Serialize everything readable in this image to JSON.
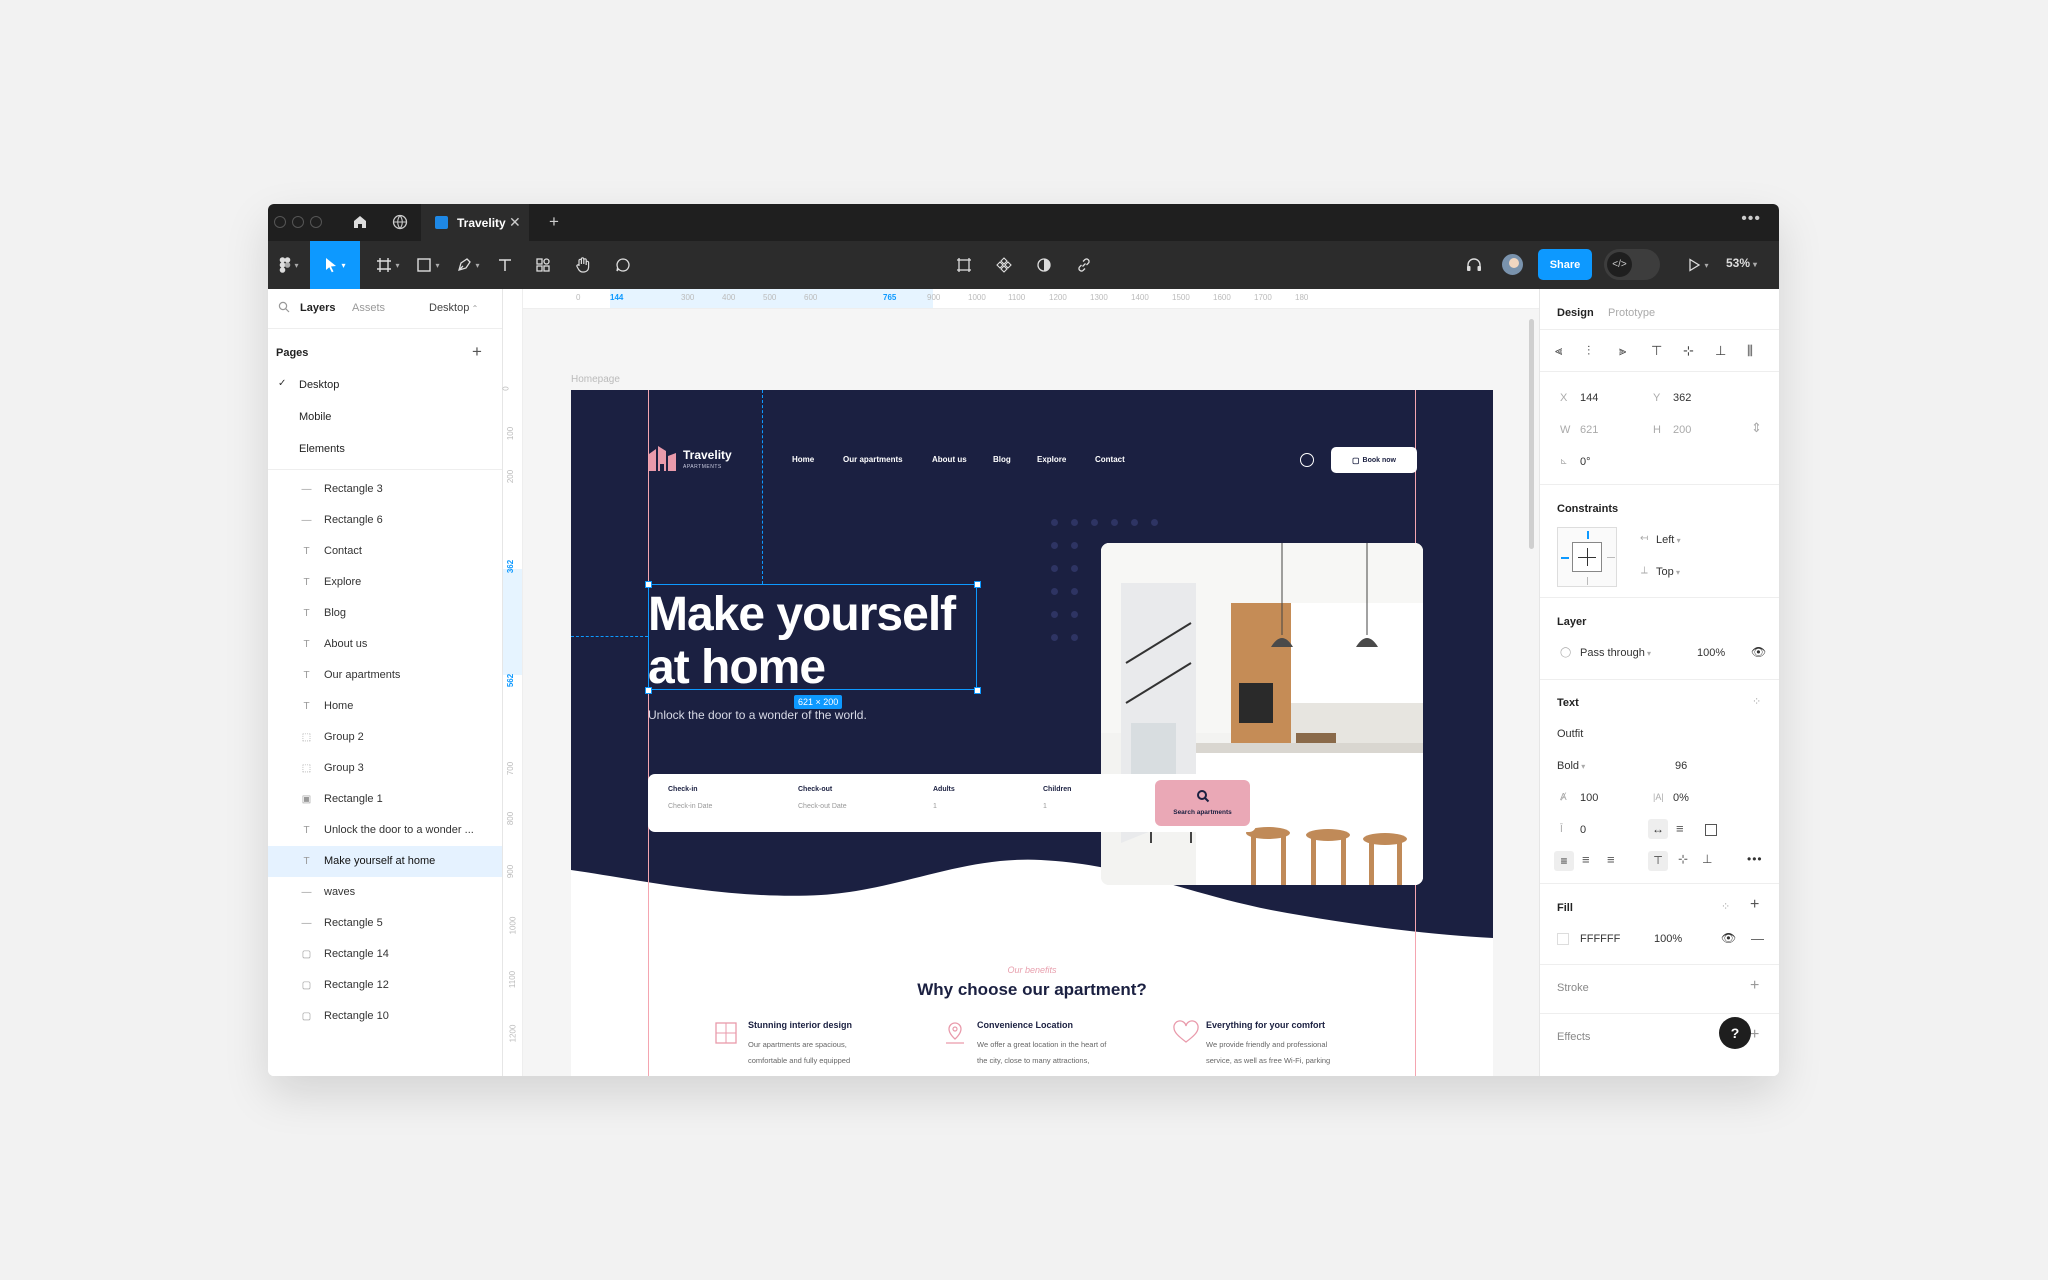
{
  "tab": {
    "title": "Travelity"
  },
  "toolbar": {
    "share_label": "Share",
    "zoom": "53%"
  },
  "left_panel": {
    "tabs": [
      "Layers",
      "Assets"
    ],
    "page_selector": "Desktop",
    "pages_title": "Pages",
    "pages": [
      "Desktop",
      "Mobile",
      "Elements"
    ],
    "layers": [
      {
        "name": "Rectangle 3",
        "icon": "line"
      },
      {
        "name": "Rectangle 6",
        "icon": "line"
      },
      {
        "name": "Contact",
        "icon": "text"
      },
      {
        "name": "Explore",
        "icon": "text"
      },
      {
        "name": "Blog",
        "icon": "text"
      },
      {
        "name": "About us",
        "icon": "text"
      },
      {
        "name": "Our apartments",
        "icon": "text"
      },
      {
        "name": "Home",
        "icon": "text"
      },
      {
        "name": "Group 2",
        "icon": "group"
      },
      {
        "name": "Group 3",
        "icon": "group"
      },
      {
        "name": "Rectangle 1",
        "icon": "image"
      },
      {
        "name": "Unlock the door to a wonder ...",
        "icon": "text"
      },
      {
        "name": "Make yourself at home",
        "icon": "text",
        "selected": true
      },
      {
        "name": "waves",
        "icon": "line"
      },
      {
        "name": "Rectangle 5",
        "icon": "line"
      },
      {
        "name": "Rectangle 14",
        "icon": "rect"
      },
      {
        "name": "Rectangle 12",
        "icon": "rect"
      },
      {
        "name": "Rectangle 10",
        "icon": "rect"
      }
    ]
  },
  "ruler_top": [
    "0",
    "144",
    "300",
    "400",
    "500",
    "600",
    "765",
    "900",
    "1000",
    "1100",
    "1200",
    "1300",
    "1400",
    "1500",
    "1600",
    "1700",
    "180"
  ],
  "ruler_left": [
    "0",
    "100",
    "200",
    "362",
    "562",
    "700",
    "800",
    "900",
    "1000",
    "1100",
    "1200"
  ],
  "canvas": {
    "frame_label": "Homepage",
    "selection_size": "621 × 200"
  },
  "site": {
    "brand": "Travelity",
    "brand_sub": "APARTMENTS",
    "nav": [
      "Home",
      "Our apartments",
      "About us",
      "Blog",
      "Explore",
      "Contact"
    ],
    "book_label": "Book now",
    "heading_line1": "Make yourself",
    "heading_line2": "at home",
    "subheading": "Unlock the door to a wonder of the world.",
    "search_fields": [
      {
        "label": "Check-in",
        "value": "Check-in Date"
      },
      {
        "label": "Check-out",
        "value": "Check-out Date"
      },
      {
        "label": "Adults",
        "value": "1"
      },
      {
        "label": "Children",
        "value": "1"
      }
    ],
    "search_button": "Search apartments",
    "benefits_kicker": "Our benefits",
    "benefits_title": "Why choose our apartment?",
    "features": [
      {
        "title": "Stunning interior design",
        "desc": "Our apartments are spacious, comfortable and fully equipped"
      },
      {
        "title": "Convenience Location",
        "desc": "We offer a great location in the heart of the city, close to many attractions,"
      },
      {
        "title": "Everything for your comfort",
        "desc": "We provide friendly and professional service, as well as free Wi-Fi, parking"
      }
    ],
    "colors": {
      "navy": "#1b2041",
      "pink": "#eaa8b6",
      "accent": "#0d99ff"
    }
  },
  "right_panel": {
    "tabs": [
      "Design",
      "Prototype"
    ],
    "x_label": "X",
    "x": "144",
    "y_label": "Y",
    "y": "362",
    "w_label": "W",
    "w": "621",
    "h_label": "H",
    "h": "200",
    "rotation": "0°",
    "constraints_title": "Constraints",
    "constraint_h": "Left",
    "constraint_v": "Top",
    "layer_title": "Layer",
    "blend": "Pass through",
    "opacity": "100%",
    "text_title": "Text",
    "font_family": "Outfit",
    "font_weight": "Bold",
    "font_size": "96",
    "line_height": "100",
    "letter_spacing": "0%",
    "paragraph_spacing": "0",
    "fill_title": "Fill",
    "fill_hex": "FFFFFF",
    "fill_opacity": "100%",
    "stroke_title": "Stroke",
    "effects_title": "Effects",
    "help": "?"
  }
}
